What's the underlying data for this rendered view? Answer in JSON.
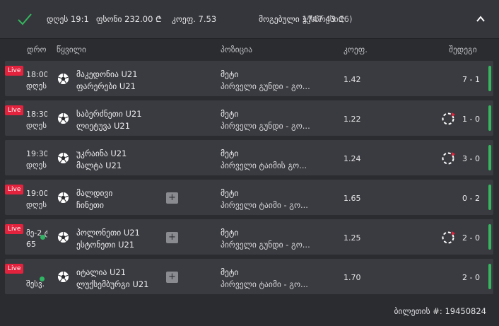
{
  "header": {
    "date": "დღეს 19:1",
    "stake": "ფსონი 232.00 ₾",
    "total_odds": "კოეფ. 7.53",
    "payout": "მოგებული 1747.43 ₾",
    "bet_type": "ექსპრესი (6)"
  },
  "columns": {
    "time": "დრო",
    "event": "წყვილი",
    "position": "პოზიცია",
    "odds": "კოეფ.",
    "result": "შედეგი"
  },
  "rows": [
    {
      "live": "Live",
      "time": "18:00",
      "date": "დღეს",
      "team1": "მაკედონია U21",
      "team2": "ფარერები U21",
      "market": "მეტი",
      "selection": "პირველი გუნდი - გო...",
      "odds": "1.42",
      "score": "7 - 1"
    },
    {
      "live": "Live",
      "time": "18:30",
      "date": "დღეს",
      "team1": "საბერძნეთი U21",
      "team2": "ლიეტუვა U21",
      "market": "მეტი",
      "selection": "პირველი გუნდი - გო...",
      "odds": "1.22",
      "score": "1 - 0"
    },
    {
      "live": "",
      "time": "19:30",
      "date": "დღეს",
      "team1": "უკრაინა U21",
      "team2": "მალტა U21",
      "market": "მეტი",
      "selection": "პირველი ტაიმის გო...",
      "odds": "1.24",
      "score": "3 - 0"
    },
    {
      "live": "Live",
      "time": "19:00",
      "date": "დღეს",
      "team1": "მალდივი",
      "team2": "ჩინეთი",
      "market": "მეტი",
      "selection": "პირველი ტაიმი - გო...",
      "odds": "1.65",
      "score": "0 - 2",
      "plus": "+"
    },
    {
      "live": "Live",
      "time": "მე-2 ტ",
      "date": "65",
      "team1": "პოლონეთი U21",
      "team2": "ესტონეთი U21",
      "market": "მეტი",
      "selection": "პირველი გუნდი - გო...",
      "odds": "1.25",
      "score": "2 - 0",
      "plus": "+"
    },
    {
      "live": "Live",
      "time": "",
      "date": "შესვ.",
      "team1": "იტალია U21",
      "team2": "ლუქსემბურგი U21",
      "market": "მეტი",
      "selection": "პირველი ტაიმი - გო...",
      "odds": "1.70",
      "score": "2 - 0",
      "plus": "+"
    }
  ],
  "footer": {
    "ticket": "ბილეთის #: 19450824"
  },
  "colors": {
    "live": "#e3223d",
    "win": "#35b55e",
    "background": "#2b2c30",
    "row": "#3a3b40"
  },
  "icons": [
    "check-icon",
    "chevron-up-icon",
    "ball-icon",
    "loading-icon",
    "plus-icon"
  ]
}
